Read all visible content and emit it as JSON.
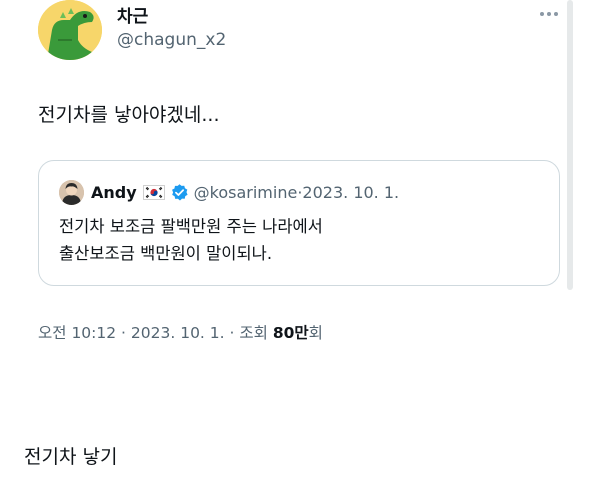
{
  "tweet": {
    "author_name": "차근",
    "author_handle": "@chagun_x2",
    "text": "전기차를 낳아야겠네...",
    "quote": {
      "author_name": "Andy",
      "author_flag": "korea-flag-icon",
      "author_handle": "@kosarimine",
      "date_sep": " · ",
      "date": "2023. 10. 1.",
      "lines": [
        "전기차 보조금 팔백만원 주는 나라에서",
        "출산보조금 백만원이 말이되나."
      ]
    },
    "meta": {
      "time": "오전 10:12",
      "sep1": " · ",
      "date": "2023. 10. 1.",
      "sep2": " · ",
      "views_label": "조회 ",
      "views_count": "80만",
      "views_suffix": "회"
    }
  },
  "caption": "전기차 낳기",
  "colors": {
    "text": "#0f1419",
    "secondary": "#536471",
    "border": "#cfd9de",
    "verified": "#1d9bf0",
    "avatar_bg": "#f7d66a",
    "dino": "#3a9a3a"
  }
}
